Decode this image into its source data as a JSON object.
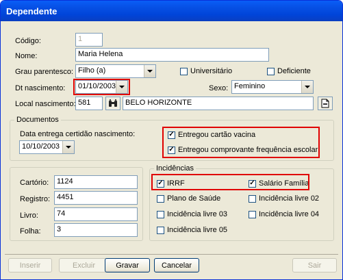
{
  "window": {
    "title": "Dependente"
  },
  "form": {
    "codigo": {
      "label": "Código:",
      "value": "1"
    },
    "nome": {
      "label": "Nome:",
      "value": "Maria Helena"
    },
    "grau": {
      "label": "Grau parentesco:",
      "value": "Filho (a)"
    },
    "universitario": {
      "label": "Universitário",
      "checked": false
    },
    "deficiente": {
      "label": "Deficiente",
      "checked": false
    },
    "dt_nascimento": {
      "label": "Dt nascimento:",
      "value": "01/10/2003"
    },
    "sexo": {
      "label": "Sexo:",
      "value": "Feminino"
    },
    "local": {
      "label": "Local nascimento:",
      "code": "581",
      "city": "BELO HORIZONTE"
    }
  },
  "documentos": {
    "title": "Documentos",
    "data_label": "Data entrega certidão nascimento:",
    "data_value": "10/10/2003",
    "cartao_vacina": {
      "label": "Entregou cartão vacina",
      "checked": true
    },
    "frequencia": {
      "label": "Entregou comprovante frequência escolar",
      "checked": true
    }
  },
  "registro": {
    "cartorio": {
      "label": "Cartório:",
      "value": "1124"
    },
    "registro": {
      "label": "Registro:",
      "value": "4451"
    },
    "livro": {
      "label": "Livro:",
      "value": "74"
    },
    "folha": {
      "label": "Folha:",
      "value": "3"
    }
  },
  "incidencias": {
    "title": "Incidências",
    "irrf": {
      "label": "IRRF",
      "checked": true
    },
    "salario_familia": {
      "label": "Salário Família",
      "checked": true
    },
    "plano_saude": {
      "label": "Plano de Saúde",
      "checked": false
    },
    "livre02": {
      "label": "Incidência livre 02",
      "checked": false
    },
    "livre03": {
      "label": "Incidência livre 03",
      "checked": false
    },
    "livre04": {
      "label": "Incidência livre 04",
      "checked": false
    },
    "livre05": {
      "label": "Incidência livre 05",
      "checked": false
    }
  },
  "buttons": {
    "inserir": "Inserir",
    "excluir": "Excluir",
    "gravar": "Gravar",
    "cancelar": "Cancelar",
    "sair": "Sair"
  },
  "icons": {
    "search": "binoculars-icon",
    "notes": "document-icon"
  },
  "colors": {
    "title_bar": "#0a5ef7",
    "highlight": "#e00000"
  }
}
